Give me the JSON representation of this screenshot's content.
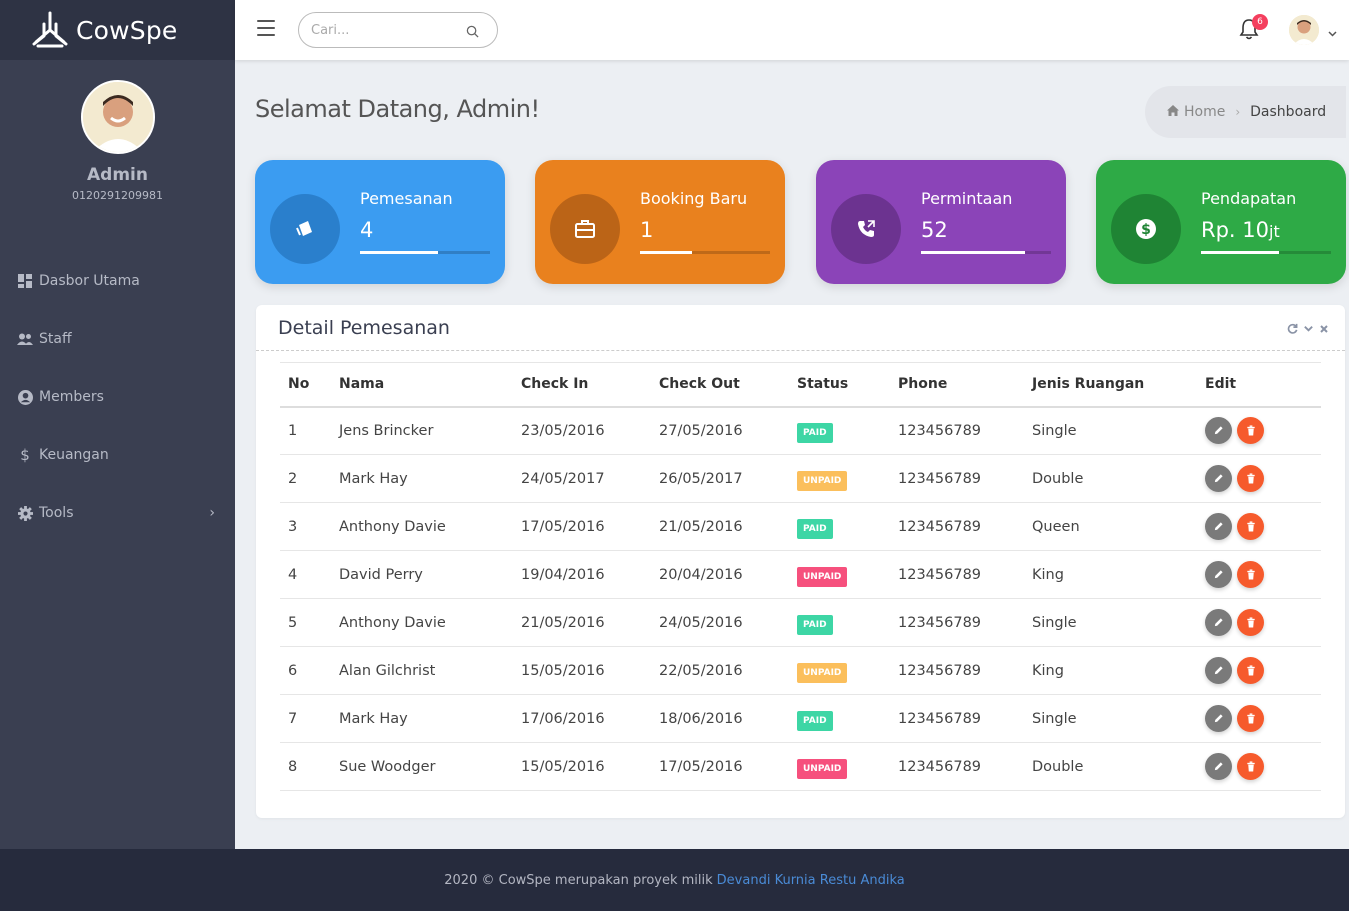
{
  "brand": {
    "name": "CowSpe"
  },
  "profile": {
    "name": "Admin",
    "id": "0120291209981"
  },
  "sidebar": {
    "items": [
      {
        "label": "Dasbor Utama",
        "icon": "dashboard-icon"
      },
      {
        "label": "Staff",
        "icon": "users-icon"
      },
      {
        "label": "Members",
        "icon": "user-circle-icon"
      },
      {
        "label": "Keuangan",
        "icon": "dollar-icon"
      },
      {
        "label": "Tools",
        "icon": "gear-icon"
      }
    ]
  },
  "topbar": {
    "search_placeholder": "Cari...",
    "notification_count": "6"
  },
  "page": {
    "welcome": "Selamat Datang, Admin!"
  },
  "breadcrumb": {
    "home": "Home",
    "current": "Dashboard"
  },
  "cards": [
    {
      "title": "Pemesanan",
      "value": "4",
      "progress": 0.6,
      "color": "#3b9cf1",
      "icon": "ticket-icon"
    },
    {
      "title": "Booking Baru",
      "value": "1",
      "progress": 0.4,
      "color": "#e9811e",
      "icon": "briefcase-icon"
    },
    {
      "title": "Permintaan",
      "value": "52",
      "progress": 0.8,
      "color": "#8b44b8",
      "icon": "phone-icon"
    },
    {
      "title": "Pendapatan",
      "value": "Rp. 10",
      "value_suffix": "jt",
      "progress": 0.6,
      "color": "#2eaa46",
      "icon": "dollar-coin-icon"
    }
  ],
  "panel": {
    "title": "Detail Pemesanan",
    "columns": [
      "No",
      "Nama",
      "Check In",
      "Check Out",
      "Status",
      "Phone",
      "Jenis Ruangan",
      "Edit"
    ],
    "rows": [
      {
        "no": "1",
        "name": "Jens Brincker",
        "check_in": "23/05/2016",
        "check_out": "27/05/2016",
        "status": "PAID",
        "status_color": "#3dd6a5",
        "phone": "123456789",
        "room": "Single"
      },
      {
        "no": "2",
        "name": "Mark Hay",
        "check_in": "24/05/2017",
        "check_out": "26/05/2017",
        "status": "UNPAID",
        "status_color": "#fbbf5c",
        "phone": "123456789",
        "room": "Double"
      },
      {
        "no": "3",
        "name": "Anthony Davie",
        "check_in": "17/05/2016",
        "check_out": "21/05/2016",
        "status": "PAID",
        "status_color": "#3dd6a5",
        "phone": "123456789",
        "room": "Queen"
      },
      {
        "no": "4",
        "name": "David Perry",
        "check_in": "19/04/2016",
        "check_out": "20/04/2016",
        "status": "UNPAID",
        "status_color": "#f6507d",
        "phone": "123456789",
        "room": "King"
      },
      {
        "no": "5",
        "name": "Anthony Davie",
        "check_in": "21/05/2016",
        "check_out": "24/05/2016",
        "status": "PAID",
        "status_color": "#3dd6a5",
        "phone": "123456789",
        "room": "Single"
      },
      {
        "no": "6",
        "name": "Alan Gilchrist",
        "check_in": "15/05/2016",
        "check_out": "22/05/2016",
        "status": "UNPAID",
        "status_color": "#fbbf5c",
        "phone": "123456789",
        "room": "King"
      },
      {
        "no": "7",
        "name": "Mark Hay",
        "check_in": "17/06/2016",
        "check_out": "18/06/2016",
        "status": "PAID",
        "status_color": "#3dd6a5",
        "phone": "123456789",
        "room": "Single"
      },
      {
        "no": "8",
        "name": "Sue Woodger",
        "check_in": "15/05/2016",
        "check_out": "17/05/2016",
        "status": "UNPAID",
        "status_color": "#f6507d",
        "phone": "123456789",
        "room": "Double"
      }
    ]
  },
  "footer": {
    "text": "2020 © CowSpe merupakan proyek milik",
    "link": "Devandi Kurnia Restu Andika"
  }
}
